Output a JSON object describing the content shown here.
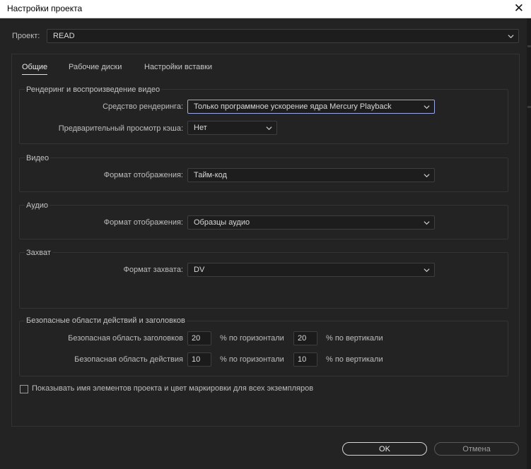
{
  "window": {
    "title": "Настройки проекта"
  },
  "project": {
    "label": "Проект:",
    "value": "READ"
  },
  "tabs": [
    {
      "label": "Общие"
    },
    {
      "label": "Рабочие диски"
    },
    {
      "label": "Настройки вставки"
    }
  ],
  "render_group": {
    "title": "Рендеринг и воспроизведение видео",
    "renderer_label": "Средство рендеринга:",
    "renderer_value": "Только программное ускорение ядра Mercury Playback",
    "cache_label": "Предварительный просмотр кэша:",
    "cache_value": "Нет"
  },
  "video_group": {
    "title": "Видео",
    "format_label": "Формат отображения:",
    "format_value": "Тайм-код"
  },
  "audio_group": {
    "title": "Аудио",
    "format_label": "Формат отображения:",
    "format_value": "Образцы аудио"
  },
  "capture_group": {
    "title": "Захват",
    "format_label": "Формат захвата:",
    "format_value": "DV"
  },
  "safe_group": {
    "title": "Безопасные области действий и заголовков",
    "title_safe_label": "Безопасная область заголовков",
    "title_safe_h": "20",
    "title_safe_v": "20",
    "action_safe_label": "Безопасная область действия",
    "action_safe_h": "10",
    "action_safe_v": "10",
    "horizontal_unit": "% по горизонтали",
    "vertical_unit": "% по вертикали"
  },
  "show_names": {
    "label": "Показывать имя элементов проекта и цвет маркировки для всех экземпляров",
    "checked": false
  },
  "buttons": {
    "ok": "OK",
    "cancel": "Отмена"
  },
  "icons": {
    "close": "close-icon",
    "chevron": "chevron-down-icon"
  },
  "colors": {
    "focus_border": "#9aa8e6",
    "background": "#232323"
  }
}
